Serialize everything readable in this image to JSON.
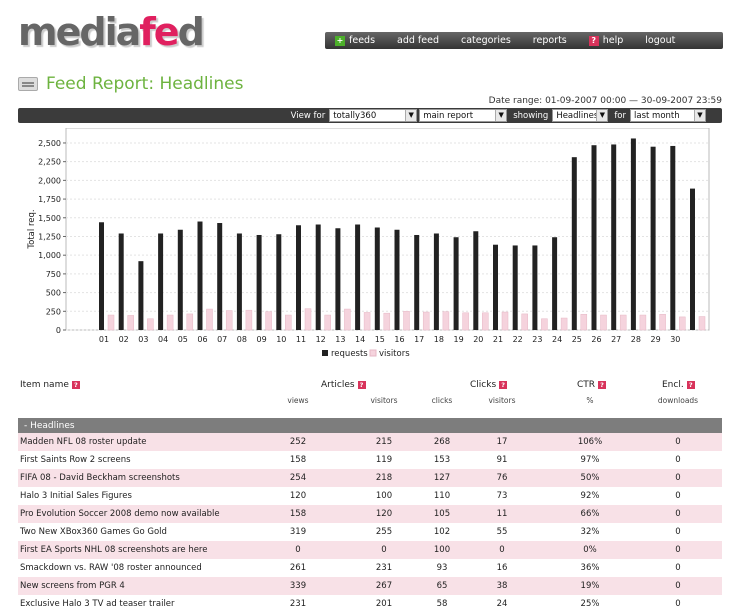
{
  "brand": {
    "logo_part1": "media",
    "logo_part2": "fe",
    "logo_part3": "d"
  },
  "nav": {
    "items": [
      {
        "label": "feeds",
        "icon": "plus-icon"
      },
      {
        "label": "add feed",
        "icon": ""
      },
      {
        "label": "categories",
        "icon": ""
      },
      {
        "label": "reports",
        "icon": ""
      },
      {
        "label": "help",
        "icon": "help-icon"
      },
      {
        "label": "logout",
        "icon": ""
      }
    ]
  },
  "page": {
    "title": "Feed Report: Headlines",
    "date_range": "Date range: 01-09-2007 00:00 — 30-09-2007 23:59"
  },
  "filters": {
    "view_for_label": "View for",
    "view_for_value": "totally360",
    "report_value": "main report",
    "showing_label": "showing",
    "showing_value": "Headlines",
    "for_label": "for",
    "period_value": "last month"
  },
  "chart_data": {
    "type": "bar",
    "ylabel": "Total req.",
    "xlabel": "",
    "ylim": [
      0,
      2700
    ],
    "yticks": [
      "0",
      "250",
      "500",
      "750",
      "1,000",
      "1,250",
      "1,500",
      "1,750",
      "2,000",
      "2,250",
      "2,500"
    ],
    "categories": [
      "01",
      "02",
      "03",
      "04",
      "05",
      "06",
      "07",
      "08",
      "09",
      "10",
      "11",
      "12",
      "13",
      "14",
      "15",
      "16",
      "17",
      "18",
      "19",
      "20",
      "21",
      "22",
      "23",
      "24",
      "25",
      "26",
      "27",
      "28",
      "29",
      "30"
    ],
    "series": [
      {
        "name": "requests",
        "color": "#222222",
        "values": [
          1440,
          1290,
          920,
          1290,
          1340,
          1450,
          1430,
          1290,
          1270,
          1280,
          1400,
          1410,
          1360,
          1410,
          1370,
          1340,
          1270,
          1290,
          1240,
          1320,
          1140,
          1130,
          1130,
          1240,
          2310,
          2470,
          2480,
          2560,
          2450,
          2460,
          1890
        ]
      },
      {
        "name": "visitors",
        "color": "#f5d3dd",
        "values": [
          200,
          195,
          150,
          200,
          215,
          280,
          260,
          265,
          245,
          200,
          285,
          200,
          280,
          235,
          225,
          250,
          240,
          245,
          230,
          230,
          240,
          215,
          150,
          160,
          210,
          200,
          200,
          200,
          210,
          175,
          180
        ]
      }
    ],
    "legend_position": "bottom"
  },
  "table": {
    "headers": {
      "item": "Item name",
      "articles": "Articles",
      "clicks": "Clicks",
      "ctr": "CTR",
      "encl": "Encl."
    },
    "subheaders": {
      "views": "views",
      "visitors": "visitors",
      "clicks": "clicks",
      "visitors2": "visitors",
      "pct": "%",
      "downloads": "downloads"
    },
    "section": "- Headlines",
    "rows": [
      {
        "name": "Madden NFL 08 roster update",
        "views": "252",
        "visitors": "215",
        "clicks": "268",
        "cvisitors": "17",
        "ctr": "106%",
        "downloads": "0"
      },
      {
        "name": "First Saints Row 2 screens",
        "views": "158",
        "visitors": "119",
        "clicks": "153",
        "cvisitors": "91",
        "ctr": "97%",
        "downloads": "0"
      },
      {
        "name": "FIFA 08 - David Beckham screenshots",
        "views": "254",
        "visitors": "218",
        "clicks": "127",
        "cvisitors": "76",
        "ctr": "50%",
        "downloads": "0"
      },
      {
        "name": "Halo 3 Initial Sales Figures",
        "views": "120",
        "visitors": "100",
        "clicks": "110",
        "cvisitors": "73",
        "ctr": "92%",
        "downloads": "0"
      },
      {
        "name": "Pro Evolution Soccer 2008 demo now available",
        "views": "158",
        "visitors": "120",
        "clicks": "105",
        "cvisitors": "11",
        "ctr": "66%",
        "downloads": "0"
      },
      {
        "name": "Two New XBox360 Games Go Gold",
        "views": "319",
        "visitors": "255",
        "clicks": "102",
        "cvisitors": "55",
        "ctr": "32%",
        "downloads": "0"
      },
      {
        "name": "First EA Sports NHL 08 screenshots are here",
        "views": "0",
        "visitors": "0",
        "clicks": "100",
        "cvisitors": "0",
        "ctr": "0%",
        "downloads": "0"
      },
      {
        "name": "Smackdown vs. RAW '08 roster announced",
        "views": "261",
        "visitors": "231",
        "clicks": "93",
        "cvisitors": "16",
        "ctr": "36%",
        "downloads": "0"
      },
      {
        "name": "New screens from PGR 4",
        "views": "339",
        "visitors": "267",
        "clicks": "65",
        "cvisitors": "38",
        "ctr": "19%",
        "downloads": "0"
      },
      {
        "name": "Exclusive Halo 3 TV ad teaser trailer",
        "views": "231",
        "visitors": "201",
        "clicks": "58",
        "cvisitors": "24",
        "ctr": "25%",
        "downloads": "0"
      }
    ]
  }
}
